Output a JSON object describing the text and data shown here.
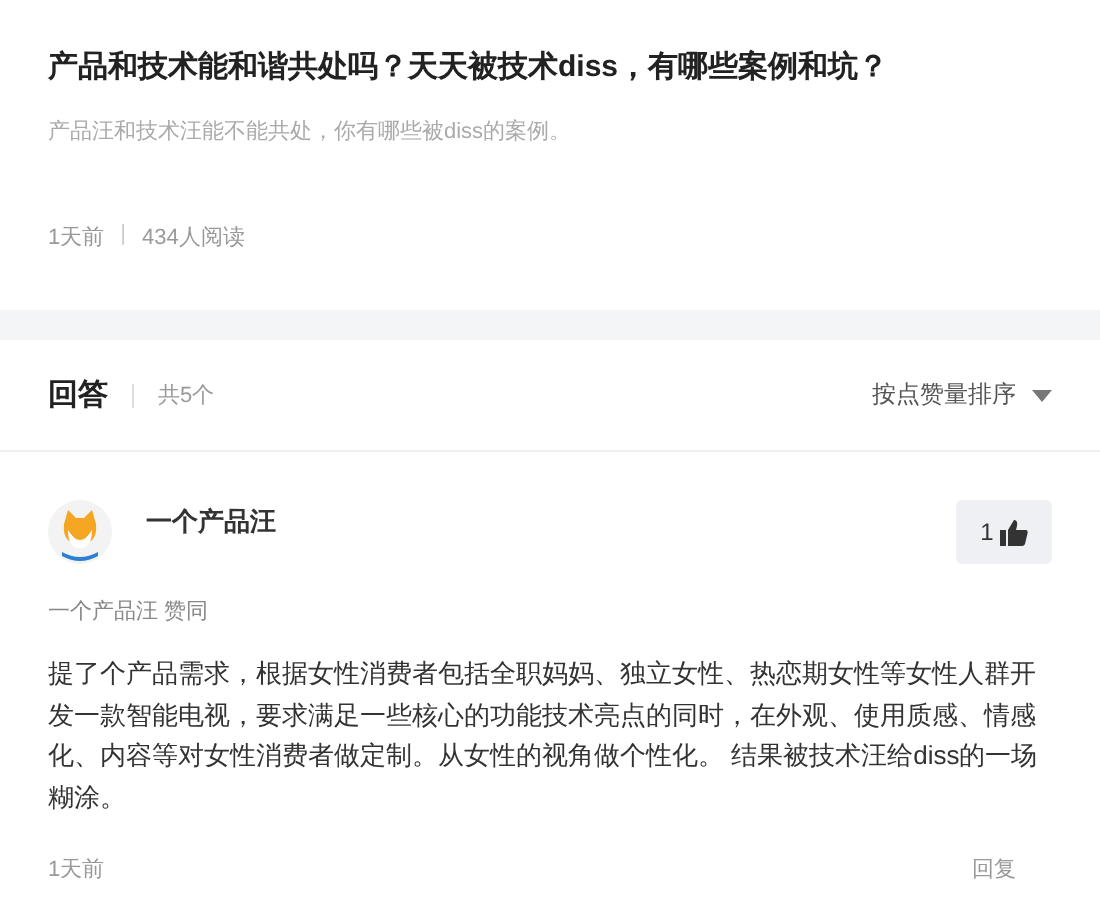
{
  "question": {
    "title": "产品和技术能和谐共处吗？天天被技术diss，有哪些案例和坑？",
    "description": "产品汪和技术汪能不能共处，你有哪些被diss的案例。",
    "time": "1天前",
    "separator": "|",
    "reads": "434人阅读"
  },
  "answers_header": {
    "title": "回答",
    "count": "共5个",
    "sort": "按点赞量排序"
  },
  "answer": {
    "author": "一个产品汪",
    "likes": "1",
    "endorsement": "一个产品汪 赞同",
    "body": "提了个产品需求，根据女性消费者包括全职妈妈、独立女性、热恋期女性等女性人群开发一款智能电视，要求满足一些核心的功能技术亮点的同时，在外观、使用质感、情感化、内容等对女性消费者做定制。从女性的视角做个性化。 结果被技术汪给diss的一场糊涂。",
    "time": "1天前",
    "reply": "回复"
  }
}
